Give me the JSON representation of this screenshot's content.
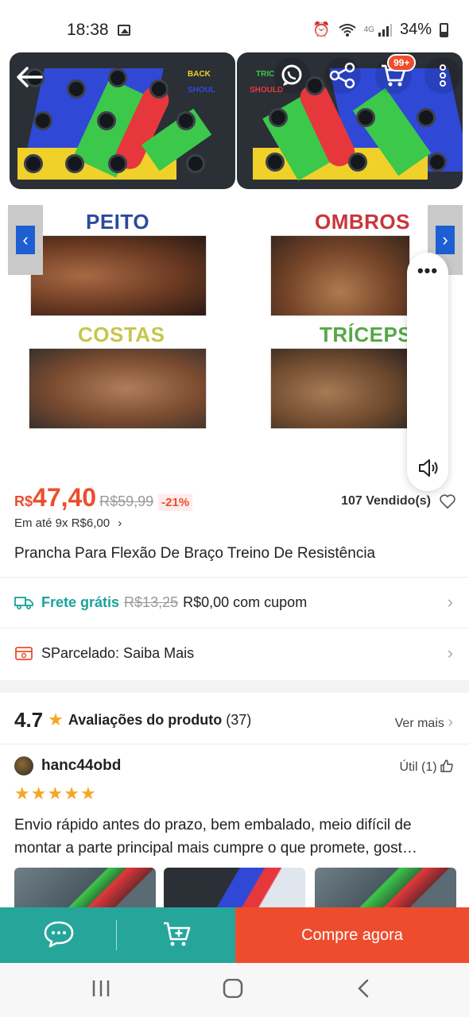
{
  "status_bar": {
    "time": "18:38",
    "network": "4G",
    "battery": "34%"
  },
  "product_image": {
    "board_left_labels": [
      "BACK",
      "SHOUL"
    ],
    "board_right_labels": [
      "TRIC",
      "SHOULD"
    ],
    "muscles": [
      "PEITO",
      "OMBROS",
      "COSTAS",
      "TRÍCEPS"
    ],
    "cart_badge": "99+"
  },
  "price": {
    "currency": "R$",
    "value": "47,40",
    "original": "R$59,99",
    "discount": "-21%",
    "sold": "107 Vendido(s)",
    "installments": "Em até 9x R$6,00",
    "installments_chevron": "›"
  },
  "product_title": "Prancha Para Flexão De Braço Treino De Resistência",
  "shipping": {
    "label": "Frete grátis",
    "old": "R$13,25",
    "new": "R$0,00 com cupom"
  },
  "sparcelado": {
    "label": "SParcelado: Saiba Mais"
  },
  "ratings": {
    "score": "4.7",
    "label": "Avaliações do produto",
    "count": "(37)",
    "ver_mais": "Ver mais"
  },
  "review": {
    "user": "hanc44obd",
    "useful": "Útil (1)",
    "stars": 5,
    "text": "Envio rápido antes do prazo, bem embalado, meio difícil de montar a parte principal mais cumpre o que promete, gost…"
  },
  "actions": {
    "buy_now": "Compre agora"
  },
  "colors": {
    "accent": "#ee4d2d",
    "teal": "#26a69a",
    "star": "#f5a623",
    "free_shipping": "#1aa39a"
  }
}
